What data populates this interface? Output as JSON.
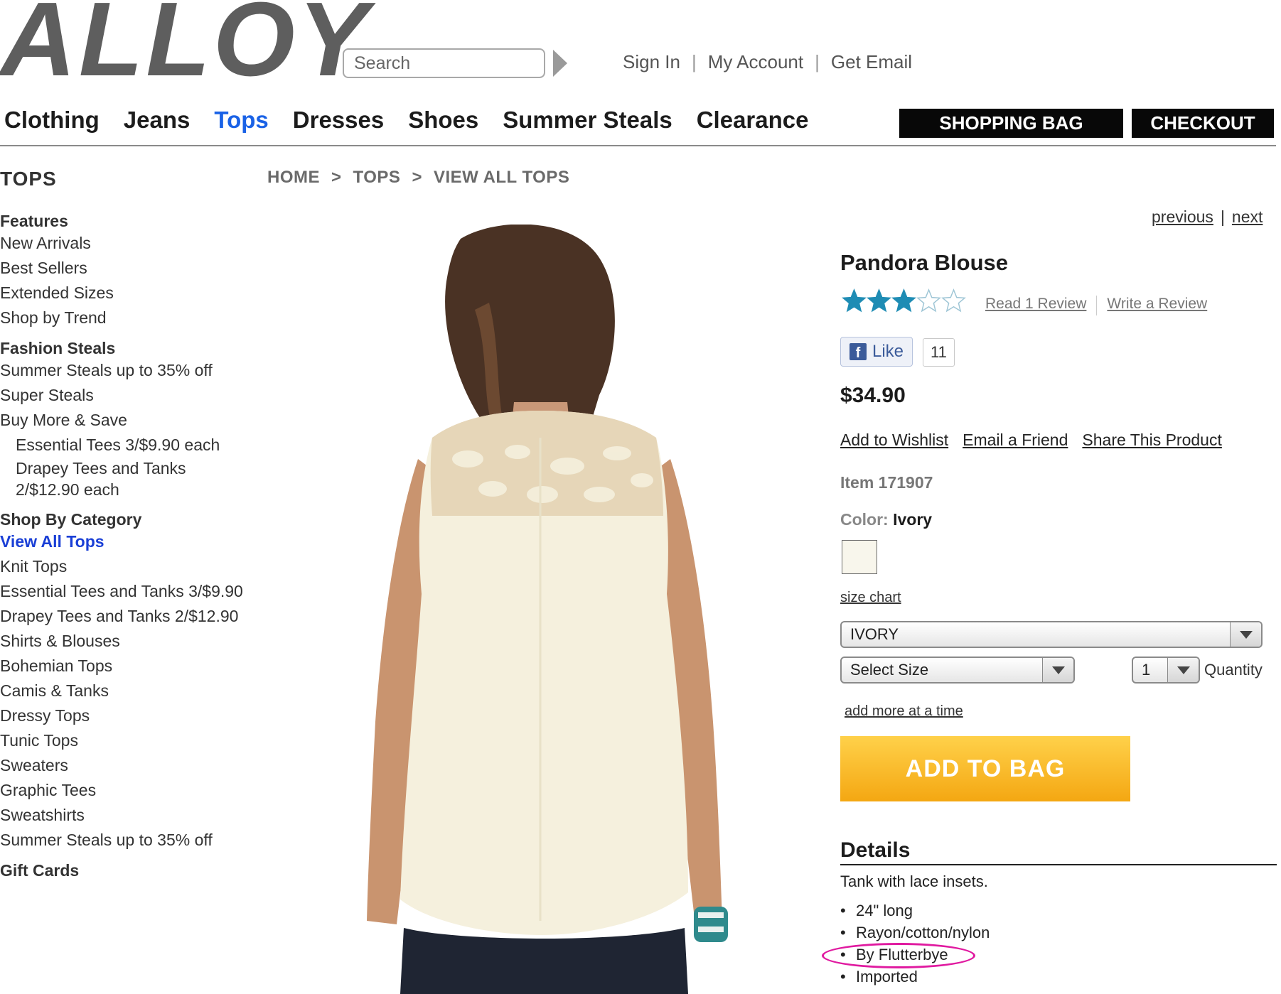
{
  "header": {
    "logo": "ALLOY",
    "search": {
      "placeholder": "Search",
      "value": ""
    },
    "account_links": {
      "sign_in": "Sign In",
      "my_account": "My Account",
      "get_email": "Get Email",
      "separator": "|"
    }
  },
  "nav": {
    "items": [
      "Clothing",
      "Jeans",
      "Tops",
      "Dresses",
      "Shoes",
      "Summer Steals",
      "Clearance"
    ],
    "active": "Tops",
    "shopping_bag": "SHOPPING BAG",
    "checkout": "CHECKOUT"
  },
  "sidebar": {
    "heading": "TOPS",
    "features": {
      "title": "Features",
      "items": [
        "New Arrivals",
        "Best Sellers",
        "Extended Sizes",
        "Shop by Trend"
      ]
    },
    "fashion_steals": {
      "title": "Fashion Steals",
      "items": [
        "Summer Steals up to 35% off",
        "Super Steals",
        "Buy More & Save"
      ],
      "sub_items": [
        "Essential Tees 3/$9.90 each",
        "Drapey Tees and Tanks",
        "2/$12.90 each"
      ]
    },
    "shop_by_category": {
      "title": "Shop By Category",
      "active_item": "View All Tops",
      "items": [
        "Knit Tops",
        "Essential Tees and Tanks 3/$9.90",
        "Drapey Tees and Tanks 2/$12.90",
        "Shirts & Blouses",
        "Bohemian Tops",
        "Camis & Tanks",
        "Dressy Tops",
        "Tunic Tops",
        "Sweaters",
        "Graphic Tees",
        "Sweatshirts",
        "Summer Steals up to 35% off"
      ]
    },
    "gift_cards": "Gift Cards"
  },
  "breadcrumb": {
    "items": [
      "HOME",
      "TOPS",
      "VIEW ALL TOPS"
    ],
    "separator": ">"
  },
  "pager": {
    "previous": "previous",
    "separator": "|",
    "next": "next"
  },
  "product": {
    "title": "Pandora Blouse",
    "rating": {
      "value": 3,
      "max": 5
    },
    "read_reviews": "Read 1 Review",
    "write_review": "Write a Review",
    "fb_like": "Like",
    "fb_count": "11",
    "price": "$34.90",
    "actions": {
      "wishlist": "Add to Wishlist",
      "email": "Email a Friend",
      "share": "Share This Product"
    },
    "item_number": "Item 171907",
    "color_label": "Color:",
    "color_value": "Ivory",
    "swatch_color": "#f8f6ec",
    "size_chart": "size chart",
    "color_select": "IVORY",
    "size_select": "Select Size",
    "quantity_select": "1",
    "quantity_label": "Quantity",
    "add_more": "add more at a time",
    "add_to_bag": "ADD TO BAG",
    "details": {
      "title": "Details",
      "description": "Tank with lace insets.",
      "bullets": [
        "24\" long",
        "Rayon/cotton/nylon",
        "By Flutterbye",
        "Imported"
      ]
    }
  },
  "colors": {
    "nav_active": "#1a62e6",
    "sidebar_active": "#1a3fd6",
    "star_fill": "#1e8cb4",
    "add_to_bag_top": "#ffd14a",
    "add_to_bag_bottom": "#f4a712",
    "highlight": "#e01aa0"
  },
  "icons": {
    "search_go": "play-arrow-icon",
    "facebook": "facebook-icon",
    "star": "star-icon",
    "dropdown": "chevron-down-icon"
  }
}
